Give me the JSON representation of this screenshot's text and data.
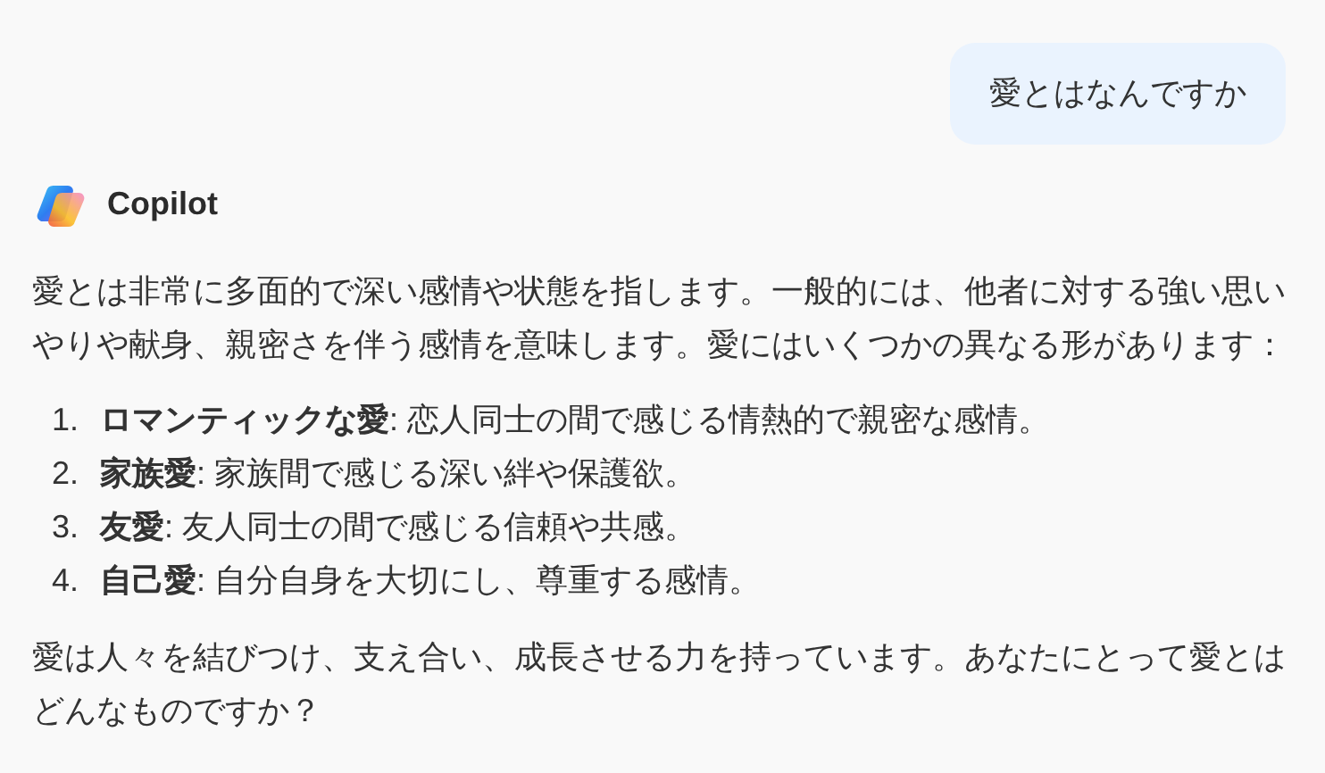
{
  "user_message": {
    "text": "愛とはなんですか"
  },
  "assistant": {
    "name": "Copilot",
    "intro": "愛とは非常に多面的で深い感情や状態を指します。一般的には、他者に対する強い思いやりや献身、親密さを伴う感情を意味します。愛にはいくつかの異なる形があります：",
    "list": [
      {
        "number": "1.",
        "text": "**ロマンティックな愛**: 恋人同士の間で感じる情熱的で親密な感情。"
      },
      {
        "number": "2.",
        "text": "**家族愛**: 家族間で感じる深い絆や保護欲。"
      },
      {
        "number": "3.",
        "text": "**友愛**: 友人同士の間で感じる信頼や共感。"
      },
      {
        "number": "4.",
        "text": "**自己愛**: 自分自身を大切にし、尊重する感情。"
      }
    ],
    "closing": "愛は人々を結びつけ、支え合い、成長させる力を持っています。あなたにとって愛とはどんなものですか？"
  }
}
